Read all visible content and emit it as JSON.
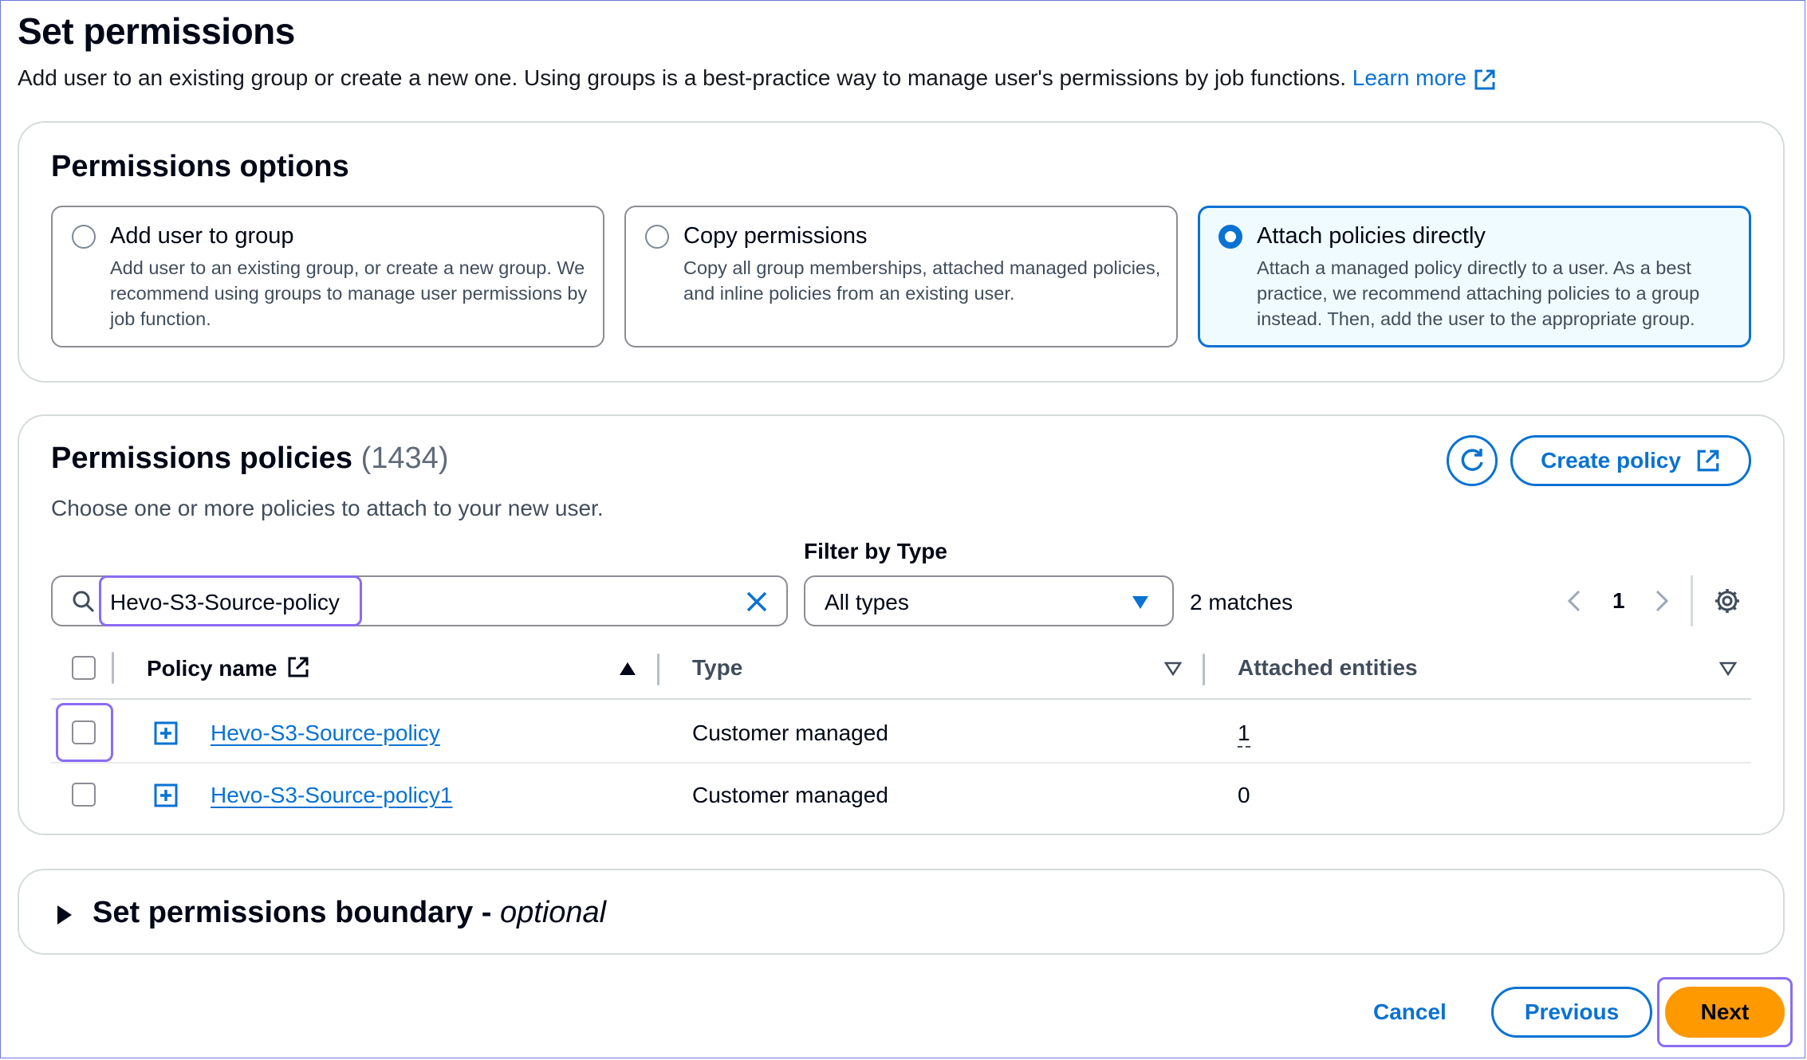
{
  "header": {
    "title": "Set permissions",
    "description": "Add user to an existing group or create a new one. Using groups is a best-practice way to manage user's permissions by job functions.",
    "learn_more": "Learn more"
  },
  "permissions_options": {
    "heading": "Permissions options",
    "options": [
      {
        "title": "Add user to group",
        "description": "Add user to an existing group, or create a new group. We recommend using groups to manage user permissions by job function.",
        "selected": false
      },
      {
        "title": "Copy permissions",
        "description": "Copy all group memberships, attached managed policies, and inline policies from an existing user.",
        "selected": false
      },
      {
        "title": "Attach policies directly",
        "description": "Attach a managed policy directly to a user. As a best practice, we recommend attaching policies to a group instead. Then, add the user to the appropriate group.",
        "selected": true
      }
    ]
  },
  "policies": {
    "heading": "Permissions policies",
    "count": "(1434)",
    "subtitle": "Choose one or more policies to attach to your new user.",
    "create_policy": "Create policy",
    "search_value": "Hevo-S3-Source-policy",
    "filter_label": "Filter by Type",
    "filter_value": "All types",
    "matches": "2 matches",
    "page": "1",
    "columns": {
      "name": "Policy name",
      "type": "Type",
      "entities": "Attached entities"
    },
    "rows": [
      {
        "name": "Hevo-S3-Source-policy",
        "type": "Customer managed",
        "entities": "1"
      },
      {
        "name": "Hevo-S3-Source-policy1",
        "type": "Customer managed",
        "entities": "0"
      }
    ]
  },
  "boundary": {
    "title": "Set permissions boundary - ",
    "optional": "optional"
  },
  "footer": {
    "cancel": "Cancel",
    "previous": "Previous",
    "next": "Next"
  },
  "colors": {
    "accent": "#0972d3",
    "primary_button": "#ff9900",
    "highlight": "#8a6cf2"
  }
}
